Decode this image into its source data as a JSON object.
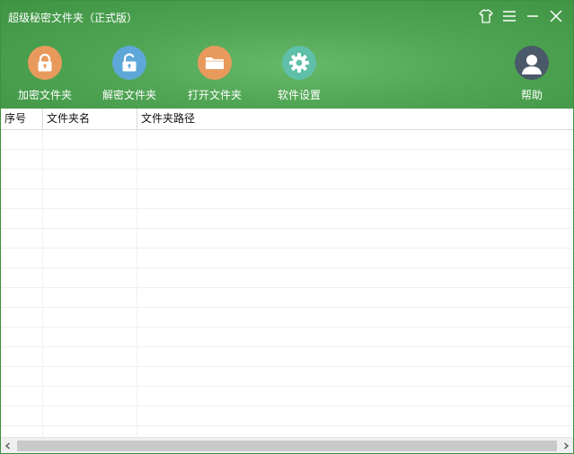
{
  "window": {
    "title": "超级秘密文件夹（正式版）",
    "controls": [
      "skin-icon",
      "menu-icon",
      "minimize-icon",
      "close-icon"
    ]
  },
  "toolbar": {
    "items": [
      {
        "label": "加密文件夹",
        "icon": "lock-icon",
        "color": "#e89a5c"
      },
      {
        "label": "解密文件夹",
        "icon": "unlock-icon",
        "color": "#5ea8d9"
      },
      {
        "label": "打开文件夹",
        "icon": "folder-icon",
        "color": "#e89a5c"
      },
      {
        "label": "软件设置",
        "icon": "gear-icon",
        "color": "#5fbfa8"
      },
      {
        "label": "帮助",
        "icon": "avatar-icon",
        "color": "#4a5a6a"
      }
    ]
  },
  "table": {
    "columns": [
      "序号",
      "文件夹名",
      "文件夹路径"
    ],
    "rows": []
  },
  "scrollbar": {
    "left": "◀",
    "right": "▶"
  },
  "colors": {
    "header_green": "#4fa553",
    "border": "#d8d8d8"
  }
}
